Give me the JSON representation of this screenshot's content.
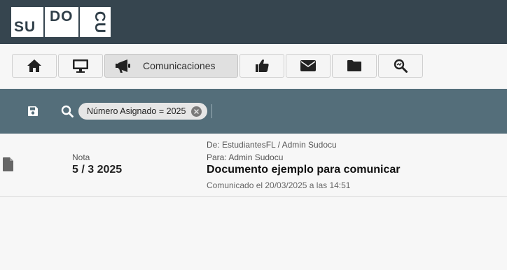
{
  "logo": {
    "part1": "SU",
    "part2": "DO",
    "part3": "CU"
  },
  "nav": {
    "home_icon": "home-icon",
    "desktop_icon": "desktop-icon",
    "comunicaciones_icon": "megaphone-icon",
    "comunicaciones_label": "Comunicaciones",
    "thumbs_icon": "thumbs-up-icon",
    "mail_icon": "envelope-icon",
    "folder_icon": "folder-icon",
    "search_icon": "search-analytics-icon"
  },
  "filter": {
    "save_icon": "save-icon",
    "search_icon": "search-icon",
    "chip_text": "Número Asignado = 2025"
  },
  "rows": [
    {
      "type": "Nota",
      "number": "5 / 3 2025",
      "from": "De: EstudiantesFL / Admin Sudocu",
      "to": "Para: Admin Sudocu",
      "subject": "Documento ejemplo para comunicar",
      "sent": "Comunicado el 20/03/2025 a las 14:51"
    }
  ],
  "colors": {
    "topbar": "#36454f",
    "filterbar": "#546e7a",
    "background": "#f7f7f7"
  }
}
